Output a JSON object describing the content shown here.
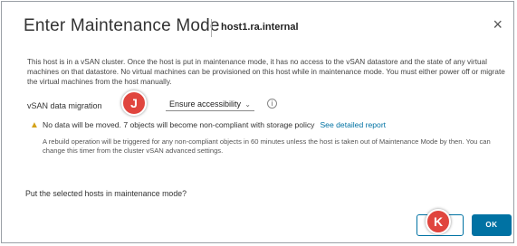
{
  "dialog": {
    "title": "Enter Maintenance Mode",
    "host": "host1.ra.internal",
    "close_glyph": "×",
    "description": "This host is in a vSAN cluster. Once the host is put in maintenance mode, it has no access to the vSAN datastore and the state of any virtual machines on that datastore. No virtual machines can be provisioned on this host while in maintenance mode. You must either power off or migrate the virtual machines from the host manually.",
    "migration_label": "vSAN data migration",
    "migration_value": "Ensure accessibility",
    "warning_text": "No data will be moved. 7 objects will become non-compliant with storage policy",
    "warning_link": "See detailed report",
    "rebuild_text": "A rebuild operation will be triggered for any non-compliant objects in 60 minutes unless the host is taken out of Maintenance Mode by then. You can change this timer from the cluster vSAN advanced settings.",
    "question": "Put the selected hosts in maintenance mode?",
    "ok_label": "OK"
  },
  "callouts": {
    "j": "J",
    "k": "K"
  },
  "icons": {
    "info": "info-icon",
    "warning": "warning-icon",
    "close": "close-icon",
    "chevron": "chevron-down-icon"
  },
  "colors": {
    "accent": "#0072a3",
    "warning": "#d4a21a",
    "callout": "#e0453e"
  }
}
